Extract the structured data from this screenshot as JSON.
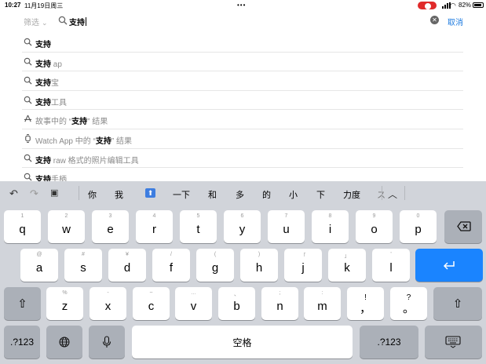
{
  "status": {
    "time": "10:27",
    "date": "11月19日周三",
    "battery": "82%"
  },
  "search": {
    "filter_label": "筛选",
    "query": "支持",
    "cancel_label": "取消"
  },
  "suggestions": [
    {
      "icon": "search-icon",
      "bold": "支持",
      "rest": ""
    },
    {
      "icon": "search-icon",
      "bold": "支持",
      "rest": " ap"
    },
    {
      "icon": "search-icon",
      "bold": "支持",
      "rest": "宝"
    },
    {
      "icon": "search-icon",
      "bold": "支持",
      "rest": "工具"
    },
    {
      "icon": "app-store-icon",
      "pre": "故事中的 “",
      "bold": "支持",
      "rest": "” 结果"
    },
    {
      "icon": "watch-icon",
      "pre": "Watch App 中的 “",
      "bold": "支持",
      "rest": "” 结果"
    },
    {
      "icon": "search-icon",
      "bold": "支持",
      "rest": " raw 格式的照片编辑工具"
    },
    {
      "icon": "search-icon",
      "bold": "支持",
      "rest": "手柄"
    }
  ],
  "candidates": [
    "你",
    "我",
    "一下",
    "和",
    "多",
    "的",
    "小",
    "下",
    "力度",
    "ス"
  ],
  "keys": {
    "row1": [
      {
        "ch": "q",
        "hint": "1"
      },
      {
        "ch": "w",
        "hint": "2"
      },
      {
        "ch": "e",
        "hint": "3"
      },
      {
        "ch": "r",
        "hint": "4"
      },
      {
        "ch": "t",
        "hint": "5"
      },
      {
        "ch": "y",
        "hint": "6"
      },
      {
        "ch": "u",
        "hint": "7"
      },
      {
        "ch": "i",
        "hint": "8"
      },
      {
        "ch": "o",
        "hint": "9"
      },
      {
        "ch": "p",
        "hint": "0"
      }
    ],
    "row2": [
      {
        "ch": "a",
        "hint": "@"
      },
      {
        "ch": "s",
        "hint": "#"
      },
      {
        "ch": "d",
        "hint": "¥"
      },
      {
        "ch": "f",
        "hint": "/"
      },
      {
        "ch": "g",
        "hint": "("
      },
      {
        "ch": "h",
        "hint": ")"
      },
      {
        "ch": "j",
        "hint": "「"
      },
      {
        "ch": "k",
        "hint": "」"
      },
      {
        "ch": "l",
        "hint": "'"
      }
    ],
    "row3": [
      {
        "ch": "z",
        "hint": "%"
      },
      {
        "ch": "x",
        "hint": "-"
      },
      {
        "ch": "c",
        "hint": "~"
      },
      {
        "ch": "v",
        "hint": "…"
      },
      {
        "ch": "b",
        "hint": "、"
      },
      {
        "ch": "n",
        "hint": ";"
      },
      {
        "ch": "m",
        "hint": ":"
      },
      {
        "ch": "，",
        "hint": "!"
      },
      {
        "ch": "。",
        "hint": "?"
      }
    ],
    "numbers_label": ".?123",
    "space_label": "空格"
  }
}
